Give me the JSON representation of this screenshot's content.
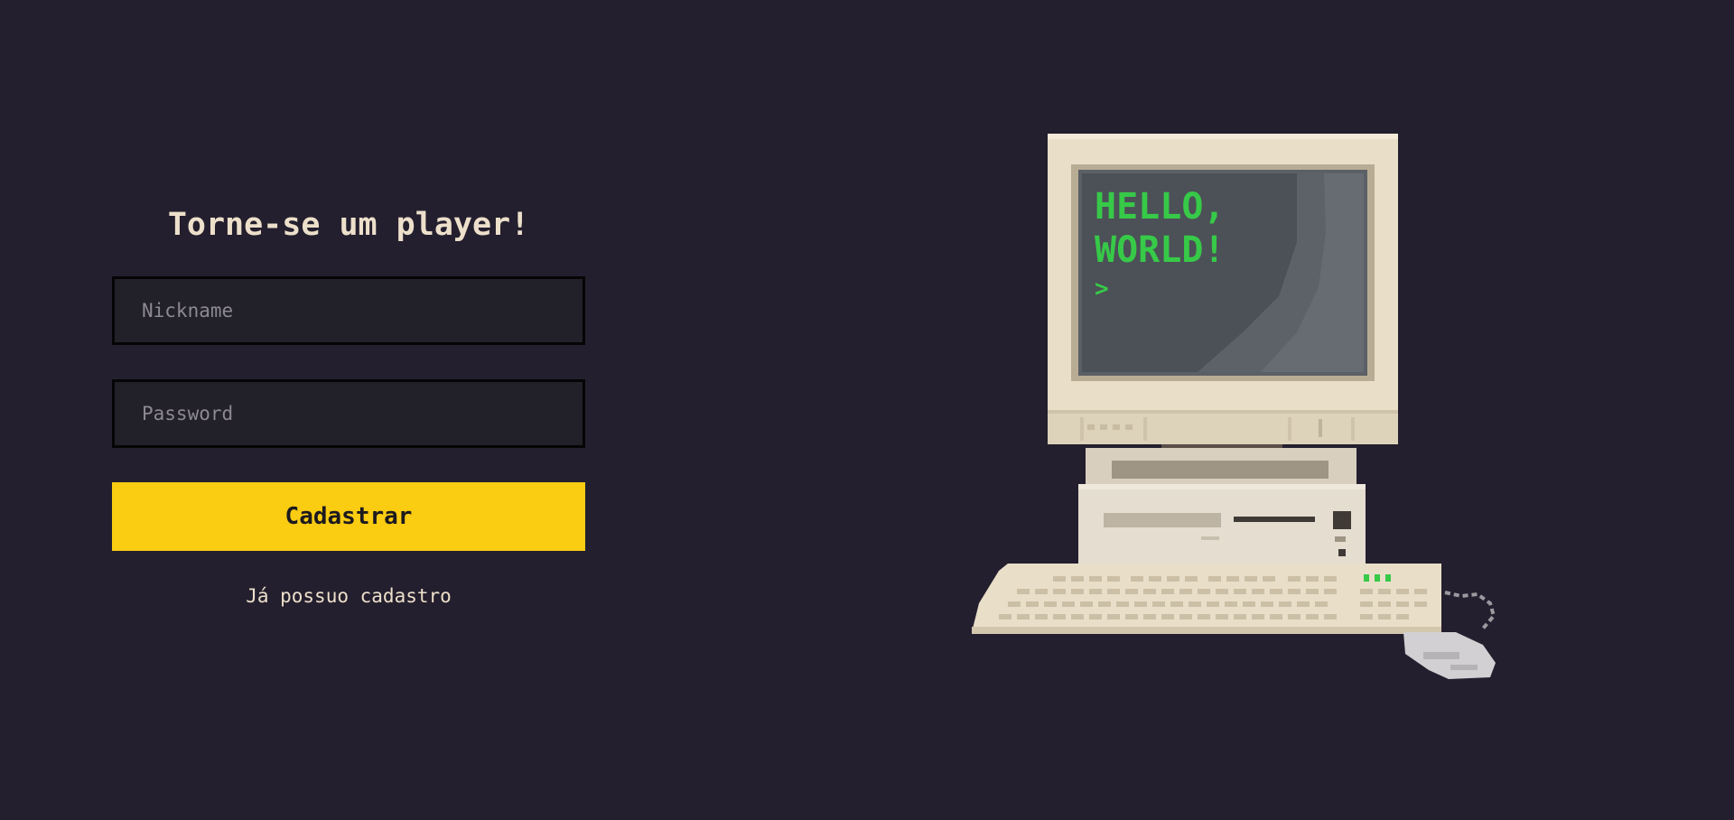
{
  "form": {
    "title": "Torne-se um player!",
    "nickname_placeholder": "Nickname",
    "nickname_value": "",
    "password_placeholder": "Password",
    "password_value": "",
    "submit_label": "Cadastrar",
    "login_link": "Já possuo cadastro"
  },
  "illustration": {
    "screen_line_1": "HELLO,",
    "screen_line_2": "WORLD!",
    "screen_prompt": ">"
  },
  "colors": {
    "background": "#241f2e",
    "accent": "#facc12",
    "text": "#ede0cb",
    "screen_green": "#37c948"
  }
}
